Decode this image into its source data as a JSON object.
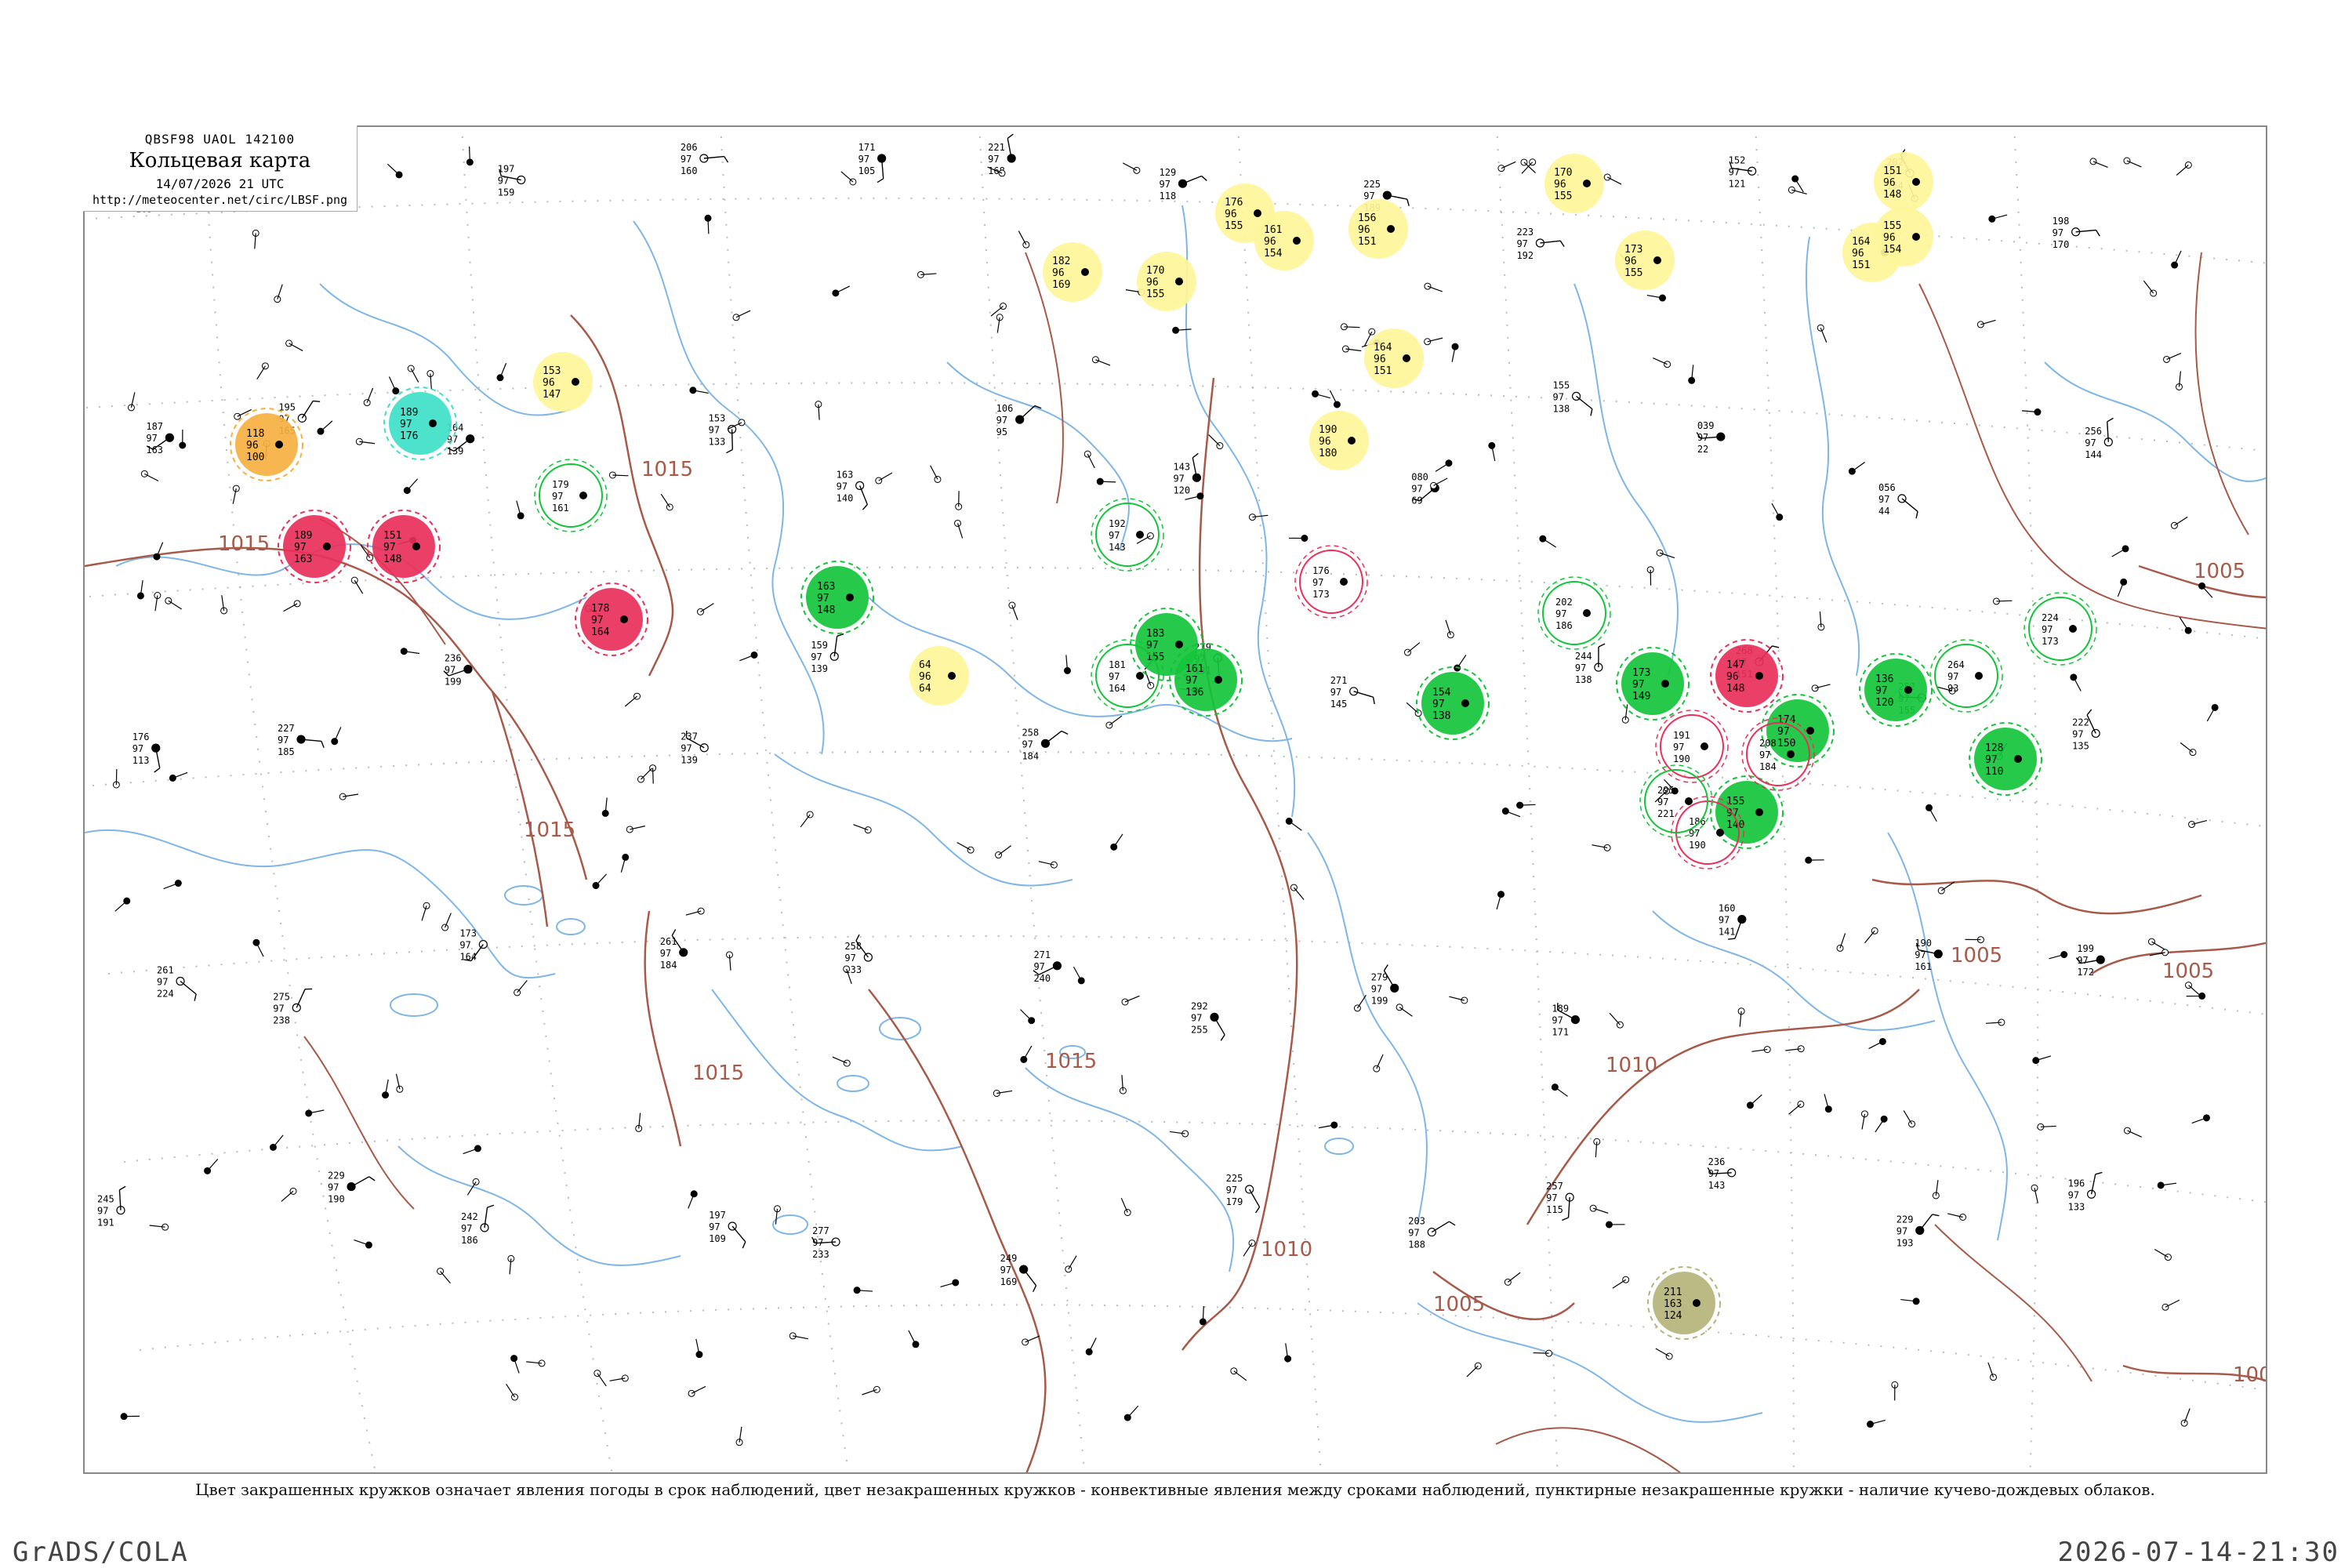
{
  "header": {
    "code": "QBSF98  UAOL  142100",
    "title": "Кольцевая карта",
    "time": "14/07/2026 21 UTC",
    "url": "http://meteocenter.net/circ/LBSF.png"
  },
  "caption": "Цвет закрашенных кружков означает явления погоды в срок наблюдений, цвет незакрашенных кружков - конвективные явления между сроками наблюдений, пунктирные незакрашенные кружки - наличие кучево-дождевых облаков.",
  "footer": {
    "left": "GrADS/COLA",
    "right": "2026-07-14-21:30"
  },
  "colors": {
    "isobar": "#a85a4a",
    "river": "#7fb6e6",
    "border": "#c8c8c8",
    "thunder": "#e8305a",
    "rain": "#13c43a",
    "shower": "#3de0c8",
    "fog": "#fff59a",
    "haze": "#f6b040",
    "dust": "#b5b37a"
  },
  "isobars": [
    {
      "label": "1015"
    },
    {
      "label": "1015"
    },
    {
      "label": "1015"
    },
    {
      "label": "1015"
    },
    {
      "label": "1015"
    },
    {
      "label": "1010"
    },
    {
      "label": "1010"
    },
    {
      "label": "1005"
    },
    {
      "label": "1005"
    },
    {
      "label": "1005"
    },
    {
      "label": "1005"
    },
    {
      "label": "100"
    }
  ],
  "filled_circles": [
    {
      "kind": "thunder",
      "top": "189",
      "left": "97",
      "bottom": "163"
    },
    {
      "kind": "thunder",
      "top": "151",
      "left": "97",
      "bottom": "148"
    },
    {
      "kind": "thunder",
      "top": "178",
      "left": "97",
      "bottom": "164"
    },
    {
      "kind": "thunder",
      "top": "147",
      "left": "96",
      "bottom": "148"
    },
    {
      "kind": "rain",
      "top": "163",
      "left": "97",
      "bottom": "148"
    },
    {
      "kind": "rain",
      "top": "183",
      "left": "97",
      "bottom": "155"
    },
    {
      "kind": "rain",
      "top": "161",
      "left": "97",
      "bottom": "136"
    },
    {
      "kind": "rain",
      "top": "154",
      "left": "97",
      "bottom": "138"
    },
    {
      "kind": "rain",
      "top": "173",
      "left": "97",
      "bottom": "149"
    },
    {
      "kind": "rain",
      "top": "174",
      "left": "97",
      "bottom": "150"
    },
    {
      "kind": "rain",
      "top": "136",
      "left": "97",
      "bottom": "120"
    },
    {
      "kind": "rain",
      "top": "128",
      "left": "97",
      "bottom": "110"
    },
    {
      "kind": "rain",
      "top": "155",
      "left": "97",
      "bottom": "140"
    },
    {
      "kind": "shower",
      "top": "189",
      "left": "97",
      "bottom": "176"
    },
    {
      "kind": "fog",
      "top": "182",
      "left": "96",
      "bottom": "169"
    },
    {
      "kind": "fog",
      "top": "170",
      "left": "96",
      "bottom": "155"
    },
    {
      "kind": "fog",
      "top": "164",
      "left": "96",
      "bottom": "151"
    },
    {
      "kind": "fog",
      "top": "173",
      "left": "96",
      "bottom": "155"
    },
    {
      "kind": "fog",
      "top": "156",
      "left": "96",
      "bottom": "151"
    },
    {
      "kind": "fog",
      "top": "176",
      "left": "96",
      "bottom": "155"
    },
    {
      "kind": "fog",
      "top": "190",
      "left": "96",
      "bottom": "180"
    },
    {
      "kind": "fog",
      "top": "64",
      "left": "96",
      "bottom": "64"
    },
    {
      "kind": "fog",
      "top": "170",
      "left": "96",
      "bottom": "155"
    },
    {
      "kind": "fog",
      "top": "151",
      "left": "96",
      "bottom": "148"
    },
    {
      "kind": "fog",
      "top": "164",
      "left": "96",
      "bottom": "151"
    },
    {
      "kind": "fog",
      "top": "155",
      "left": "96",
      "bottom": "154"
    },
    {
      "kind": "fog",
      "top": "161",
      "left": "96",
      "bottom": "154"
    },
    {
      "kind": "fog",
      "top": "153",
      "left": "96",
      "bottom": "147"
    },
    {
      "kind": "haze",
      "top": "118",
      "left": "96",
      "bottom": "100"
    },
    {
      "kind": "dust",
      "top": "211",
      "left": "163",
      "bottom": "124"
    }
  ],
  "open_circles": [
    {
      "kind": "thunder",
      "top": "191",
      "left": "97",
      "bottom": "190"
    },
    {
      "kind": "thunder",
      "top": "186",
      "left": "97",
      "bottom": "190"
    },
    {
      "kind": "thunder",
      "top": "176",
      "left": "97",
      "bottom": "173"
    },
    {
      "kind": "thunder",
      "top": "208",
      "left": "97",
      "bottom": "184"
    },
    {
      "kind": "rain",
      "top": "179",
      "left": "97",
      "bottom": "161"
    },
    {
      "kind": "rain",
      "top": "192",
      "left": "97",
      "bottom": "143"
    },
    {
      "kind": "rain",
      "top": "295",
      "left": "97",
      "bottom": "221"
    },
    {
      "kind": "rain",
      "top": "264",
      "left": "97",
      "bottom": "93"
    },
    {
      "kind": "rain",
      "top": "224",
      "left": "97",
      "bottom": "173"
    },
    {
      "kind": "rain",
      "top": "181",
      "left": "97",
      "bottom": "164"
    },
    {
      "kind": "rain",
      "top": "202",
      "left": "97",
      "bottom": "186"
    }
  ],
  "stations": [
    {
      "top": "180",
      "left": "97",
      "bottom": "163"
    },
    {
      "top": "210",
      "left": "97",
      "bottom": "175"
    },
    {
      "top": "197",
      "left": "97",
      "bottom": "159"
    },
    {
      "top": "206",
      "left": "97",
      "bottom": "160"
    },
    {
      "top": "171",
      "left": "97",
      "bottom": "105"
    },
    {
      "top": "221",
      "left": "97",
      "bottom": "168"
    },
    {
      "top": "129",
      "left": "97",
      "bottom": "118"
    },
    {
      "top": "225",
      "left": "97",
      "bottom": "189"
    },
    {
      "top": "223",
      "left": "97",
      "bottom": "192"
    },
    {
      "top": "152",
      "left": "97",
      "bottom": "121"
    },
    {
      "top": "202",
      "left": "97",
      "bottom": "164"
    },
    {
      "top": "198",
      "left": "97",
      "bottom": "170"
    },
    {
      "top": "187",
      "left": "97",
      "bottom": "163"
    },
    {
      "top": "195",
      "left": "97",
      "bottom": "165"
    },
    {
      "top": "164",
      "left": "97",
      "bottom": "139"
    },
    {
      "top": "153",
      "left": "97",
      "bottom": "133"
    },
    {
      "top": "163",
      "left": "97",
      "bottom": "140"
    },
    {
      "top": "106",
      "left": "97",
      "bottom": "95"
    },
    {
      "top": "143",
      "left": "97",
      "bottom": "120"
    },
    {
      "top": "080",
      "left": "97",
      "bottom": "69"
    },
    {
      "top": "155",
      "left": "97",
      "bottom": "138"
    },
    {
      "top": "039",
      "left": "97",
      "bottom": "22"
    },
    {
      "top": "056",
      "left": "97",
      "bottom": "44"
    },
    {
      "top": "256",
      "left": "97",
      "bottom": "144"
    },
    {
      "top": "176",
      "left": "97",
      "bottom": "113"
    },
    {
      "top": "227",
      "left": "97",
      "bottom": "185"
    },
    {
      "top": "236",
      "left": "97",
      "bottom": "199"
    },
    {
      "top": "237",
      "left": "97",
      "bottom": "139"
    },
    {
      "top": "159",
      "left": "97",
      "bottom": "139"
    },
    {
      "top": "258",
      "left": "97",
      "bottom": "184"
    },
    {
      "top": "279",
      "left": "97",
      "bottom": "131"
    },
    {
      "top": "271",
      "left": "97",
      "bottom": "145"
    },
    {
      "top": "244",
      "left": "97",
      "bottom": "138"
    },
    {
      "top": "268",
      "left": "97",
      "bottom": "151"
    },
    {
      "top": "252",
      "left": "97",
      "bottom": "155"
    },
    {
      "top": "222",
      "left": "97",
      "bottom": "135"
    },
    {
      "top": "261",
      "left": "97",
      "bottom": "224"
    },
    {
      "top": "275",
      "left": "97",
      "bottom": "238"
    },
    {
      "top": "173",
      "left": "97",
      "bottom": "164"
    },
    {
      "top": "261",
      "left": "97",
      "bottom": "184"
    },
    {
      "top": "258",
      "left": "97",
      "bottom": "233"
    },
    {
      "top": "271",
      "left": "97",
      "bottom": "240"
    },
    {
      "top": "292",
      "left": "97",
      "bottom": "255"
    },
    {
      "top": "279",
      "left": "97",
      "bottom": "199"
    },
    {
      "top": "189",
      "left": "97",
      "bottom": "171"
    },
    {
      "top": "160",
      "left": "97",
      "bottom": "141"
    },
    {
      "top": "190",
      "left": "97",
      "bottom": "161"
    },
    {
      "top": "199",
      "left": "97",
      "bottom": "172"
    },
    {
      "top": "245",
      "left": "97",
      "bottom": "191"
    },
    {
      "top": "229",
      "left": "97",
      "bottom": "190"
    },
    {
      "top": "242",
      "left": "97",
      "bottom": "186"
    },
    {
      "top": "197",
      "left": "97",
      "bottom": "109"
    },
    {
      "top": "277",
      "left": "97",
      "bottom": "233"
    },
    {
      "top": "249",
      "left": "97",
      "bottom": "169"
    },
    {
      "top": "225",
      "left": "97",
      "bottom": "179"
    },
    {
      "top": "203",
      "left": "97",
      "bottom": "188"
    },
    {
      "top": "257",
      "left": "97",
      "bottom": "115"
    },
    {
      "top": "236",
      "left": "97",
      "bottom": "143"
    },
    {
      "top": "229",
      "left": "97",
      "bottom": "193"
    },
    {
      "top": "196",
      "left": "97",
      "bottom": "133"
    }
  ]
}
